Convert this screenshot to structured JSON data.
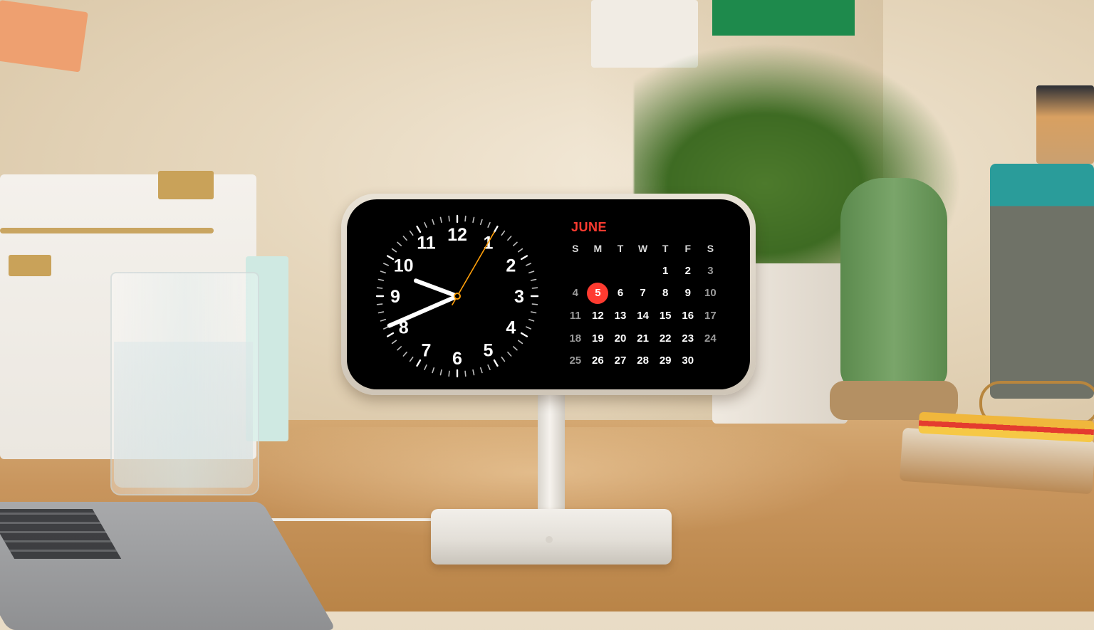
{
  "clock": {
    "numerals": [
      "12",
      "1",
      "2",
      "3",
      "4",
      "5",
      "6",
      "7",
      "8",
      "9",
      "10",
      "11"
    ],
    "time": {
      "hour": 9,
      "minute": 41,
      "second": 5
    },
    "accent_color": "#ff9f0a"
  },
  "calendar": {
    "month": "JUNE",
    "weekdays": [
      "S",
      "M",
      "T",
      "W",
      "T",
      "F",
      "S"
    ],
    "weeks": [
      [
        "",
        "",
        "",
        "",
        "1",
        "2",
        "3"
      ],
      [
        "4",
        "5",
        "6",
        "7",
        "8",
        "9",
        "10"
      ],
      [
        "11",
        "12",
        "13",
        "14",
        "15",
        "16",
        "17"
      ],
      [
        "18",
        "19",
        "20",
        "21",
        "22",
        "23",
        "24"
      ],
      [
        "25",
        "26",
        "27",
        "28",
        "29",
        "30",
        ""
      ]
    ],
    "today": "5",
    "today_color": "#ff3b30"
  }
}
